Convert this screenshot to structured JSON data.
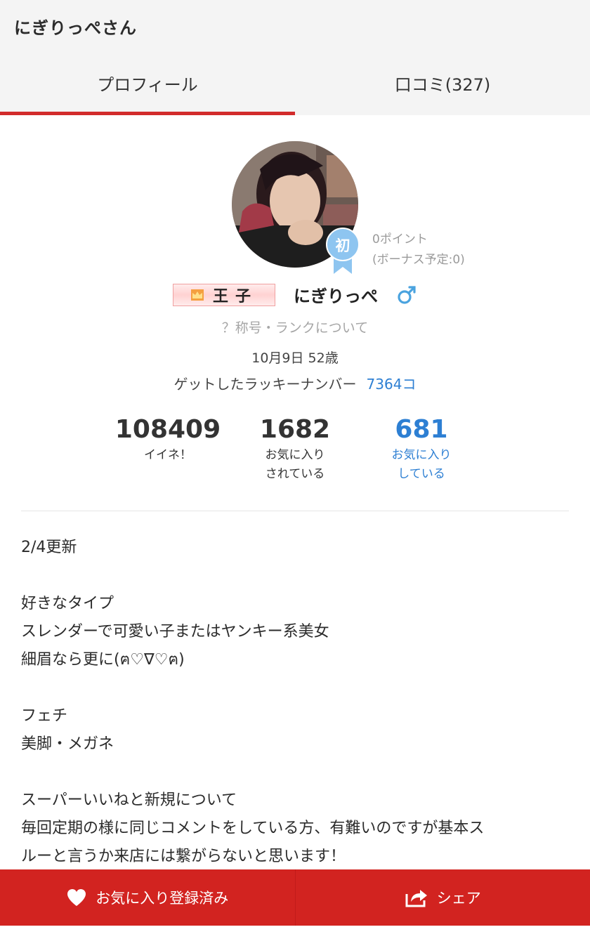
{
  "header": {
    "title": "にぎりっぺさん"
  },
  "tabs": [
    {
      "label": "プロフィール",
      "active": true
    },
    {
      "label": "口コミ(327)",
      "active": false
    }
  ],
  "profile": {
    "points": "0ポイント",
    "bonus": "(ボーナス予定:0)",
    "badge_label": "初",
    "rank_title": "王子",
    "username": "にぎりっぺ",
    "gender_symbol": "♂",
    "rank_link": "？称号・ランクについて",
    "birth": "10月9日 52歳",
    "lucky_label": "ゲットしたラッキーナンバー",
    "lucky_count": "7364コ"
  },
  "stats": [
    {
      "value": "108409",
      "label1": "イイネ！",
      "label2": ""
    },
    {
      "value": "1682",
      "label1": "お気に入り",
      "label2": "されている"
    },
    {
      "value": "681",
      "label1": "お気に入り",
      "label2": "している"
    }
  ],
  "bio": [
    "2/4更新",
    "",
    "好きなタイプ",
    "スレンダーで可愛い子またはヤンキー系美女",
    "細眉なら更に(ฅ♡∇♡ฅ)",
    "",
    "フェチ",
    "美脚・メガネ",
    "",
    "スーパーいいねと新規について",
    "毎回定期の様に同じコメントをしている方、有難いのですが基本ス",
    "ルーと言うか来店には繋がらないと思います！"
  ],
  "bottom": {
    "favorite_label": "お気に入り登録済み",
    "share_label": "シェア"
  },
  "colors": {
    "accent_red": "#d22320",
    "link_blue": "#2d7fd3",
    "badge_blue": "#8ec5f0"
  },
  "icons": {
    "favorite": "heart-icon",
    "share": "share-icon",
    "gender": "male-icon",
    "rank": "crown-icon"
  }
}
